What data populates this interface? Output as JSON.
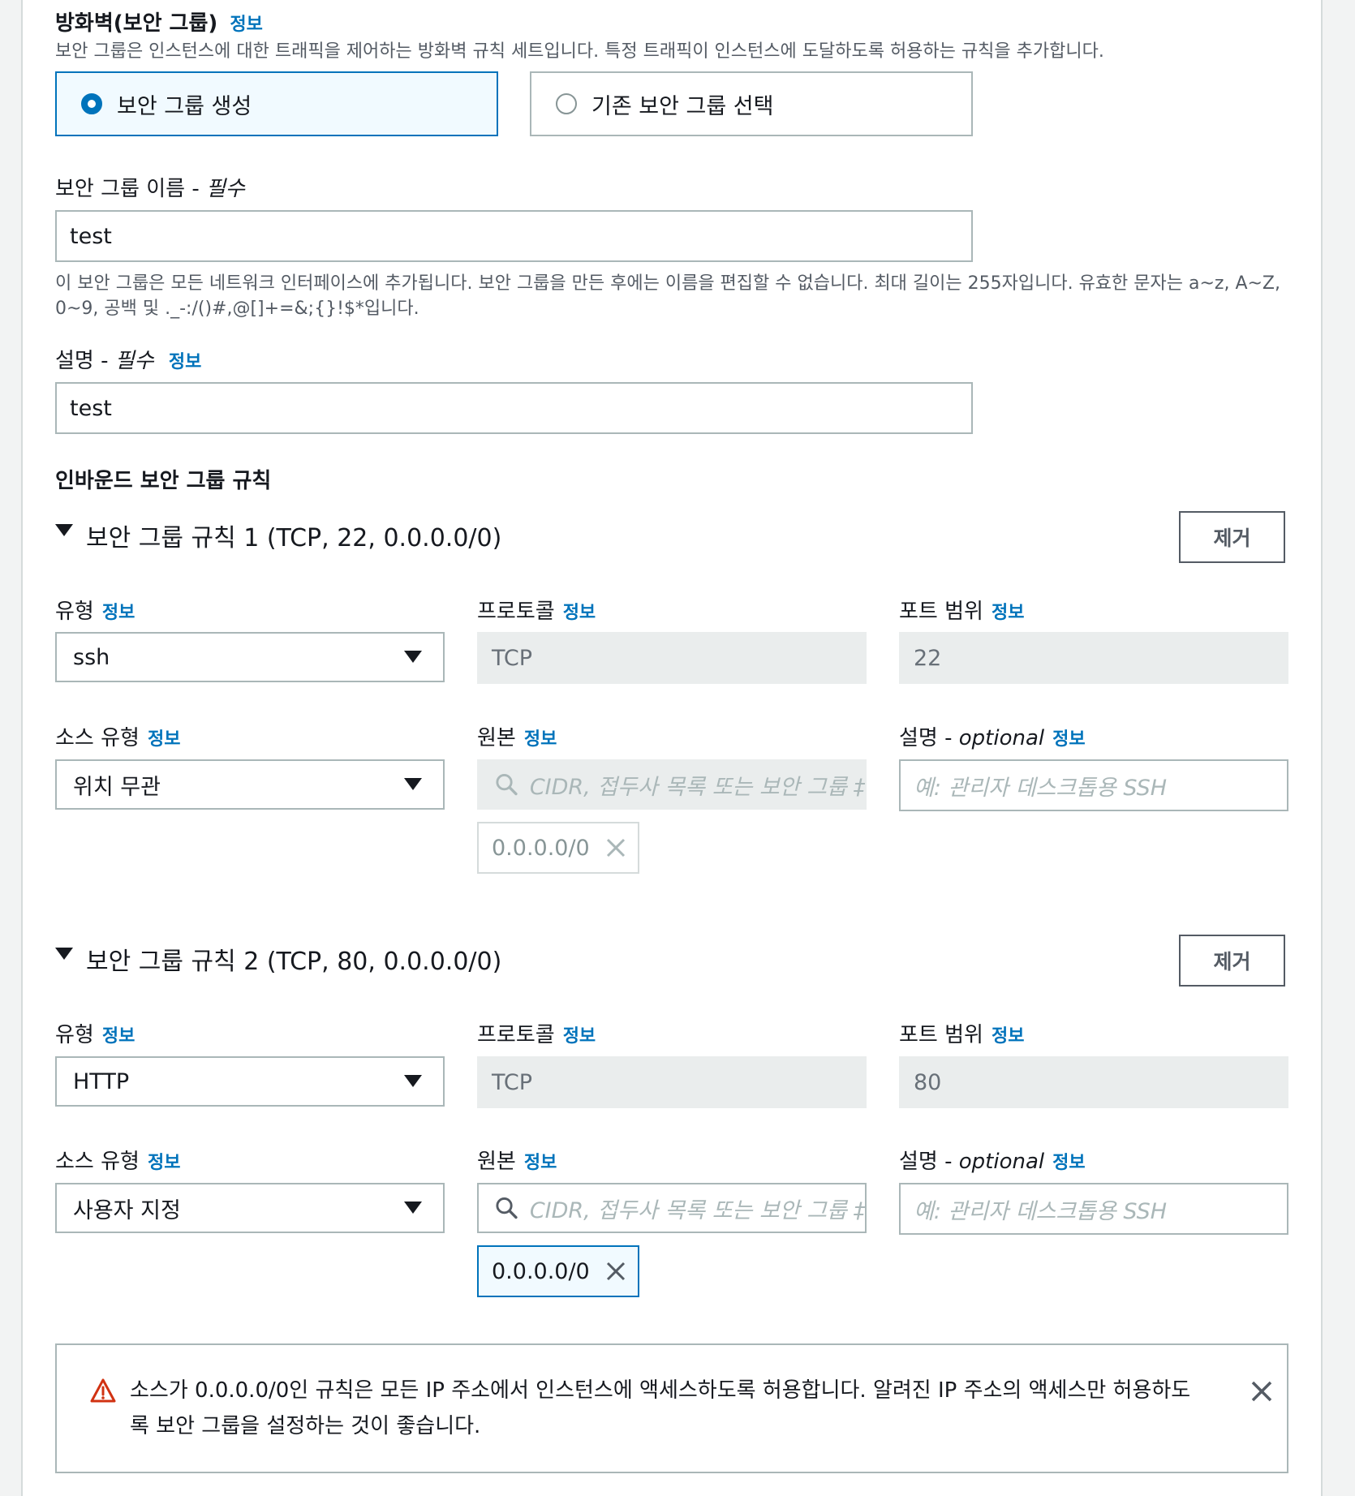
{
  "firewall": {
    "title": "방화벽(보안 그룹)",
    "info": "정보",
    "description": "보안 그룹은 인스턴스에 대한 트래픽을 제어하는 방화벽 규칙 세트입니다. 특정 트래픽이 인스턴스에 도달하도록 허용하는 규칙을 추가합니다.",
    "option_create": "보안 그룹 생성",
    "option_existing": "기존 보안 그룹 선택",
    "selected_option": "option_create"
  },
  "name_field": {
    "label": "보안 그룹 이름 - ",
    "required": "필수",
    "value": "test",
    "hint_line1": "이 보안 그룹은 모든 네트워크 인터페이스에 추가됩니다. 보안 그룹을 만든 후에는 이름을 편집할 수 없습니다. 최대 길이는 255자입니다. 유효한 문자는 a~z, A~Z,",
    "hint_line2": "0~9, 공백 및 ._-:/()#,@[]+=&;{}!$*입니다."
  },
  "desc_field": {
    "label": "설명 - ",
    "required": "필수",
    "info": "정보",
    "value": "test"
  },
  "inbound": {
    "title": "인바운드 보안 그룹 규칙",
    "labels": {
      "type": "유형",
      "protocol": "프로토콜",
      "port_range": "포트 범위",
      "source_type": "소스 유형",
      "source": "원본",
      "description": "설명 - ",
      "optional": "optional",
      "info": "정보"
    },
    "remove": "제거",
    "source_placeholder": "CIDR, 접두사 목록 또는 보안 그룹 ‡",
    "desc_placeholder": "예: 관리자 데스크톱용 SSH",
    "rules": [
      {
        "title": "보안 그룹 규칙 1 (TCP, 22, 0.0.0.0/0)",
        "type": "ssh",
        "protocol": "TCP",
        "port": "22",
        "source_type": "위치 무관",
        "cidr": "0.0.0.0/0"
      },
      {
        "title": "보안 그룹 규칙 2 (TCP, 80, 0.0.0.0/0)",
        "type": "HTTP",
        "protocol": "TCP",
        "port": "80",
        "source_type": "사용자 지정",
        "cidr": "0.0.0.0/0"
      }
    ]
  },
  "warning": {
    "line1": "소스가 0.0.0.0/0인 규칙은 모든 IP 주소에서 인스턴스에 액세스하도록 허용합니다. 알려진 IP 주소의 액세스만 허용하도",
    "line2": "록 보안 그룹을 설정하는 것이 좋습니다."
  },
  "colors": {
    "accent": "#0073bb",
    "warning": "#d13212",
    "disabled_bg": "#eaeded"
  }
}
